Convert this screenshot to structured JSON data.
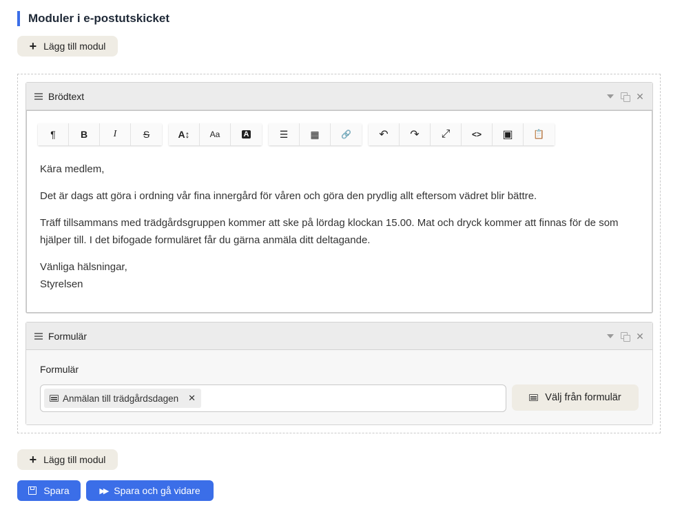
{
  "section": {
    "title": "Moduler i e-postutskicket"
  },
  "add_module_label": "Lägg till modul",
  "modules": [
    {
      "title": "Brödtext",
      "toolbar": {
        "groups": [
          [
            {
              "name": "paragraph",
              "glyph": "¶"
            },
            {
              "name": "bold",
              "glyph": "B"
            },
            {
              "name": "italic",
              "glyph": "I"
            },
            {
              "name": "strikethrough",
              "glyph": "S"
            }
          ],
          [
            {
              "name": "font-size",
              "glyph": "A↕"
            },
            {
              "name": "font-family",
              "glyph": "Aa"
            },
            {
              "name": "text-color",
              "glyph": "A"
            }
          ],
          [
            {
              "name": "unordered-list",
              "glyph": "☰"
            },
            {
              "name": "table",
              "glyph": "▦"
            },
            {
              "name": "link",
              "glyph": "🔗"
            }
          ],
          [
            {
              "name": "undo",
              "glyph": "↶"
            },
            {
              "name": "redo",
              "glyph": "↷"
            },
            {
              "name": "fullscreen",
              "glyph": "⤢"
            },
            {
              "name": "code-view",
              "glyph": "<>"
            },
            {
              "name": "image",
              "glyph": "▣"
            },
            {
              "name": "paste",
              "glyph": "📋"
            }
          ]
        ]
      },
      "content": {
        "greeting": "Kära medlem,",
        "p1": "Det är dags att göra i ordning vår fina innergård för våren och göra den prydlig allt eftersom vädret blir bättre.",
        "p2": "Träff tillsammans med trädgårdsgruppen kommer att ske på lördag klockan 15.00. Mat och dryck kommer att finnas för de som hjälper till. I det bifogade formuläret får du gärna anmäla ditt deltagande.",
        "closing": "Vänliga hälsningar,",
        "signature": "Styrelsen"
      }
    },
    {
      "title": "Formulär",
      "field_label": "Formulär",
      "selected_tag": "Anmälan till trädgårdsdagen",
      "choose_button": "Välj från formulär"
    }
  ],
  "buttons": {
    "save": "Spara",
    "save_continue": "Spara och gå vidare"
  },
  "colors": {
    "accent": "#3b6ee8",
    "secondary_button": "#efece4"
  }
}
